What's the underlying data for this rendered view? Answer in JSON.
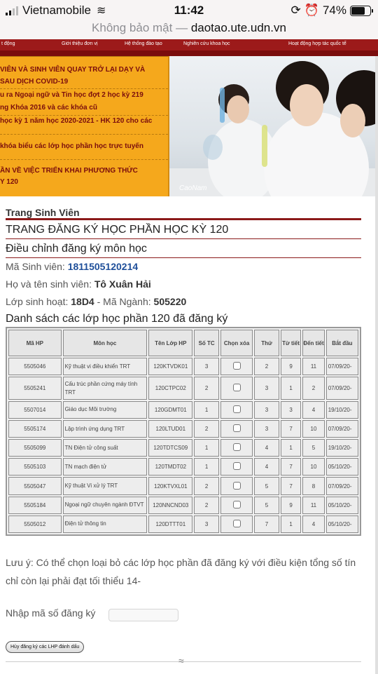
{
  "status_bar": {
    "carrier": "Vietnamobile",
    "time": "11:42",
    "battery": "74%",
    "battery_level": 0.74
  },
  "browser": {
    "security": "Không bảo mật —",
    "host": "daotao.ute.udn.vn"
  },
  "nav": {
    "items": [
      "t động",
      "Giới thiệu đơn vị",
      "Hệ thống đào tạo",
      "Nghiên cứu khoa học",
      "Hoạt động hợp tác quốc tế"
    ]
  },
  "announcements": [
    "VIÊN VÀ SINH VIÊN QUAY TRỞ LẠI DẠY VÀ",
    "SAU DỊCH COVID-19",
    "u ra Ngoại ngữ và Tin học đợt 2 học kỳ 219",
    "ng Khóa 2016 và các khóa cũ",
    "học kỳ 1 năm học 2020-2021 - HK 120 cho các",
    "khóa biểu các lớp học phần học trực tuyến",
    "ẦN VỀ VIỆC TRIỂN KHAI PHƯƠNG THỨC",
    "Y 120"
  ],
  "photo_signature": "CaoNam",
  "page": {
    "section_title": "Trang Sinh Viên",
    "heading": "TRANG ĐĂNG KÝ HỌC PHẦN HỌC KỲ 120",
    "subheading": "Điều chỉnh đăng ký môn học",
    "student_id_label": "Mã Sinh viên:",
    "student_id": "1811505120214",
    "student_name_label": "Họ và tên sinh viên:",
    "student_name": "Tô Xuân Hải",
    "class_label": "Lớp sinh hoạt:",
    "class": "18D4",
    "major_label": "- Mã Ngành:",
    "major": "505220",
    "list_title": "Danh sách các lớp học phần 120 đã đăng ký"
  },
  "table": {
    "headers": [
      "Mã HP",
      "Môn học",
      "Tên Lớp HP",
      "Số TC",
      "Chọn xóa",
      "Thứ",
      "Từ tiết",
      "Đến tiết",
      "Bắt đầu"
    ],
    "rows": [
      [
        "5505046",
        "Kỹ thuật vi điều khiển TRT",
        "120KTVDK01",
        "3",
        "2",
        "9",
        "11",
        "07/09/20-"
      ],
      [
        "5505241",
        "Cấu trúc phần cứng máy tính TRT",
        "120CTPC02",
        "2",
        "3",
        "1",
        "2",
        "07/09/20-"
      ],
      [
        "5507014",
        "Giáo dục Môi trường",
        "120GDMT01",
        "1",
        "3",
        "3",
        "4",
        "19/10/20-"
      ],
      [
        "5505174",
        "Lập trình ứng dụng TRT",
        "120LTUD01",
        "2",
        "3",
        "7",
        "10",
        "07/09/20-"
      ],
      [
        "5505099",
        "TN Điện tử công suất",
        "120TDTCS09",
        "1",
        "4",
        "1",
        "5",
        "19/10/20-"
      ],
      [
        "5505103",
        "TN mạch điện tử",
        "120TMDT02",
        "1",
        "4",
        "7",
        "10",
        "05/10/20-"
      ],
      [
        "5505047",
        "Kỹ thuật Vi xử lý TRT",
        "120KTVXL01",
        "2",
        "5",
        "7",
        "8",
        "07/09/20-"
      ],
      [
        "5505184",
        "Ngoại ngữ chuyên ngành ĐTVT",
        "120NNCND03",
        "2",
        "5",
        "9",
        "11",
        "05/10/20-"
      ],
      [
        "5505012",
        "Điện tử thông tin",
        "120DTTT01",
        "3",
        "7",
        "1",
        "4",
        "05/10/20-"
      ]
    ]
  },
  "note": "Lưu ý: Có thể chọn loại bỏ các lớp học phần đã đăng ký với điều kiện tổng số tín chỉ còn lại phải đạt tối thiểu 14-",
  "register": {
    "label": "Nhập mã số đăng ký",
    "cancel_button": "Hủy đăng ký các LHP đánh dấu"
  }
}
